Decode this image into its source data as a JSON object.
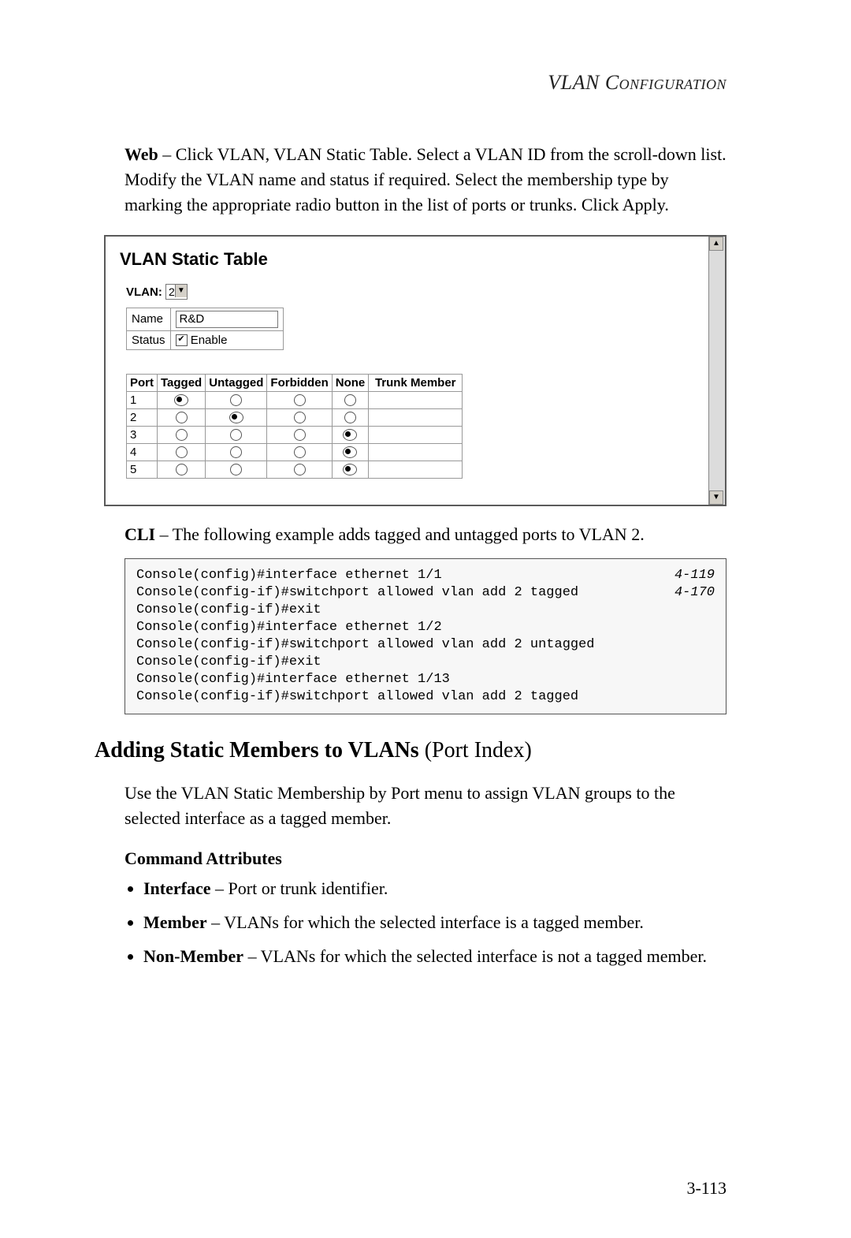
{
  "header": "VLAN Configuration",
  "intro": {
    "lead_bold": "Web",
    "lead_rest": " – Click VLAN, VLAN Static Table. Select a VLAN ID from the scroll-down list. Modify the VLAN name and status if required. Select the membership type by marking the appropriate radio button in the list of ports or trunks. Click Apply."
  },
  "figure": {
    "title": "VLAN Static Table",
    "vlan_label": "VLAN:",
    "vlan_value": "2",
    "name_label": "Name",
    "name_value": "R&D",
    "status_label": "Status",
    "enable_label": "Enable",
    "columns": [
      "Port",
      "Tagged",
      "Untagged",
      "Forbidden",
      "None",
      "Trunk Member"
    ],
    "rows": [
      {
        "port": "1",
        "sel": "Tagged"
      },
      {
        "port": "2",
        "sel": "Untagged"
      },
      {
        "port": "3",
        "sel": "None"
      },
      {
        "port": "4",
        "sel": "None"
      },
      {
        "port": "5",
        "sel": "None"
      }
    ]
  },
  "cli_intro": {
    "lead_bold": "CLI",
    "lead_rest": " – The following example adds tagged and untagged ports to VLAN 2."
  },
  "cli_lines": [
    {
      "cmd": "Console(config)#interface ethernet 1/1",
      "ref": "4-119"
    },
    {
      "cmd": "Console(config-if)#switchport allowed vlan add 2 tagged",
      "ref": "4-170"
    },
    {
      "cmd": "Console(config-if)#exit",
      "ref": ""
    },
    {
      "cmd": "Console(config)#interface ethernet 1/2",
      "ref": ""
    },
    {
      "cmd": "Console(config-if)#switchport allowed vlan add 2 untagged",
      "ref": ""
    },
    {
      "cmd": "Console(config-if)#exit",
      "ref": ""
    },
    {
      "cmd": "Console(config)#interface ethernet 1/13",
      "ref": ""
    },
    {
      "cmd": "Console(config-if)#switchport allowed vlan add 2 tagged",
      "ref": ""
    }
  ],
  "section": {
    "bold": "Adding Static Members to VLANs",
    "rest": " (Port Index)"
  },
  "section_body": "Use the VLAN Static Membership by Port menu to assign VLAN groups to the selected interface as a tagged member.",
  "cmd_attr_heading": "Command Attributes",
  "attrs": [
    {
      "b": "Interface",
      "rest": " – Port or trunk identifier."
    },
    {
      "b": "Member",
      "rest": " – VLANs for which the selected interface is a tagged member."
    },
    {
      "b": "Non-Member",
      "rest": " – VLANs for which the selected interface is not a tagged member."
    }
  ],
  "page_number": "3-113",
  "chart_data": {
    "type": "table",
    "title": "VLAN Static Table — port membership for VLAN 2 (R&D, Enabled)",
    "columns": [
      "Port",
      "Tagged",
      "Untagged",
      "Forbidden",
      "None",
      "Trunk Member"
    ],
    "rows": [
      {
        "Port": 1,
        "Tagged": true,
        "Untagged": false,
        "Forbidden": false,
        "None": false,
        "Trunk Member": ""
      },
      {
        "Port": 2,
        "Tagged": false,
        "Untagged": true,
        "Forbidden": false,
        "None": false,
        "Trunk Member": ""
      },
      {
        "Port": 3,
        "Tagged": false,
        "Untagged": false,
        "Forbidden": false,
        "None": true,
        "Trunk Member": ""
      },
      {
        "Port": 4,
        "Tagged": false,
        "Untagged": false,
        "Forbidden": false,
        "None": true,
        "Trunk Member": ""
      },
      {
        "Port": 5,
        "Tagged": false,
        "Untagged": false,
        "Forbidden": false,
        "None": true,
        "Trunk Member": ""
      }
    ]
  }
}
